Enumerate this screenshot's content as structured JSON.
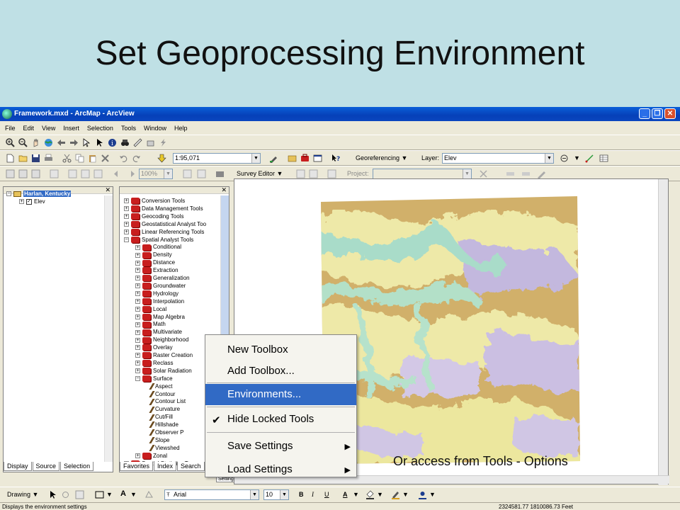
{
  "slide": {
    "title": "Set Geoprocessing Environment",
    "caption": "Or access from Tools - Options"
  },
  "window": {
    "title": "Framework.mxd - ArcMap - ArcView",
    "controls": [
      "_",
      "❐",
      "✕"
    ]
  },
  "menubar": [
    "File",
    "Edit",
    "View",
    "Insert",
    "Selection",
    "Tools",
    "Window",
    "Help"
  ],
  "toolbar": {
    "scale": "1:95,071",
    "georeferencing": "Georeferencing ▼",
    "layer_label": "Layer:",
    "layer_value": "Elev",
    "survey_editor": "Survey Editor ▼",
    "zoom": "100%",
    "project_label": "Project:"
  },
  "toc": {
    "items": [
      {
        "label": "Harlan, Kentucky",
        "depth": 0
      },
      {
        "label": "Elev",
        "depth": 1
      }
    ],
    "tabs": [
      "Display",
      "Source",
      "Selection"
    ]
  },
  "toolbox": {
    "items": [
      {
        "label": "Conversion Tools",
        "depth": 0,
        "kind": "box"
      },
      {
        "label": "Data Management Tools",
        "depth": 0,
        "kind": "box"
      },
      {
        "label": "Geocoding Tools",
        "depth": 0,
        "kind": "box"
      },
      {
        "label": "Geostatistical Analyst Too",
        "depth": 0,
        "kind": "box"
      },
      {
        "label": "Linear Referencing Tools",
        "depth": 0,
        "kind": "box"
      },
      {
        "label": "Spatial Analyst Tools",
        "depth": 0,
        "kind": "box"
      },
      {
        "label": "Conditional",
        "depth": 1,
        "kind": "box"
      },
      {
        "label": "Density",
        "depth": 1,
        "kind": "box"
      },
      {
        "label": "Distance",
        "depth": 1,
        "kind": "box"
      },
      {
        "label": "Extraction",
        "depth": 1,
        "kind": "box"
      },
      {
        "label": "Generalization",
        "depth": 1,
        "kind": "box"
      },
      {
        "label": "Groundwater",
        "depth": 1,
        "kind": "box"
      },
      {
        "label": "Hydrology",
        "depth": 1,
        "kind": "box"
      },
      {
        "label": "Interpolation",
        "depth": 1,
        "kind": "box"
      },
      {
        "label": "Local",
        "depth": 1,
        "kind": "box"
      },
      {
        "label": "Map Algebra",
        "depth": 1,
        "kind": "box"
      },
      {
        "label": "Math",
        "depth": 1,
        "kind": "box"
      },
      {
        "label": "Multivariate",
        "depth": 1,
        "kind": "box"
      },
      {
        "label": "Neighborhood",
        "depth": 1,
        "kind": "box"
      },
      {
        "label": "Overlay",
        "depth": 1,
        "kind": "box"
      },
      {
        "label": "Raster Creation",
        "depth": 1,
        "kind": "box"
      },
      {
        "label": "Reclass",
        "depth": 1,
        "kind": "box"
      },
      {
        "label": "Solar Radiation",
        "depth": 1,
        "kind": "box"
      },
      {
        "label": "Surface",
        "depth": 1,
        "kind": "box"
      },
      {
        "label": "Aspect",
        "depth": 2,
        "kind": "tool"
      },
      {
        "label": "Contour",
        "depth": 2,
        "kind": "tool"
      },
      {
        "label": "Contour List",
        "depth": 2,
        "kind": "tool"
      },
      {
        "label": "Curvature",
        "depth": 2,
        "kind": "tool"
      },
      {
        "label": "Cut/Fill",
        "depth": 2,
        "kind": "tool"
      },
      {
        "label": "Hillshade",
        "depth": 2,
        "kind": "tool"
      },
      {
        "label": "Observer P",
        "depth": 2,
        "kind": "tool"
      },
      {
        "label": "Slope",
        "depth": 2,
        "kind": "tool"
      },
      {
        "label": "Viewshed",
        "depth": 2,
        "kind": "tool"
      },
      {
        "label": "Zonal",
        "depth": 1,
        "kind": "box"
      },
      {
        "label": "Spatial Statistics To",
        "depth": 0,
        "kind": "box"
      }
    ],
    "tabs": [
      "Favorites",
      "Index",
      "Search"
    ],
    "load_settings_stub": "Load Settings"
  },
  "context_menu": {
    "items": [
      {
        "label": "New Toolbox",
        "highlighted": false,
        "checked": false,
        "submenu": false
      },
      {
        "label": "Add Toolbox...",
        "highlighted": false,
        "checked": false,
        "submenu": false
      },
      {
        "label": "Environments...",
        "highlighted": true,
        "checked": false,
        "submenu": false
      },
      {
        "label": "Hide Locked Tools",
        "highlighted": false,
        "checked": true,
        "submenu": false
      },
      {
        "label": "Save Settings",
        "highlighted": false,
        "checked": false,
        "submenu": true
      },
      {
        "label": "Load Settings",
        "highlighted": false,
        "checked": false,
        "submenu": true
      }
    ]
  },
  "drawing_toolbar": {
    "drawing": "Drawing ▼",
    "font": "Arial",
    "size": "10",
    "bold": "B",
    "italic": "I",
    "underline": "U"
  },
  "status": {
    "message": "Displays the environment settings",
    "coords": "2324581.77  1810086.73 Feet"
  },
  "colors": {
    "slide_bg": "#bfe0e5",
    "titlebar": "#0a5fd8",
    "highlight": "#316ac5",
    "map_low": "#a8dcc8",
    "map_mid": "#f0eb9c",
    "map_ridge": "#c8a35c",
    "map_high": "#b8a8d8"
  }
}
